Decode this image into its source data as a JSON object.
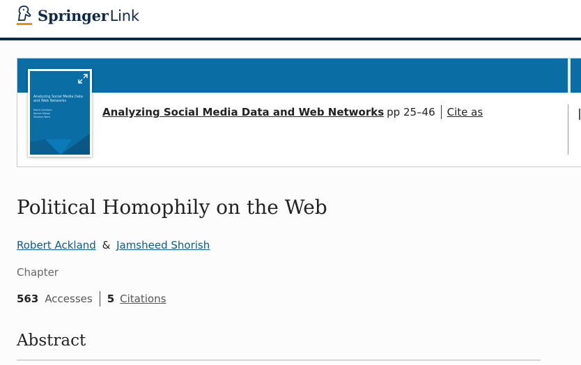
{
  "header": {
    "logo": {
      "brand": "Springer",
      "suffix": "Link",
      "icon": "springer-horse-icon",
      "color": "#0e2a4a",
      "accent": "#f08c00"
    }
  },
  "book": {
    "cover": {
      "title": "Analyzing Social Media Data and Web Networks",
      "editors": [
        "Marta Cantijoch",
        "Rachel Gibson",
        "Stephen Ward"
      ],
      "color": "#0a6ea5"
    },
    "title": "Analyzing Social Media Data and Web Networks",
    "pages": "pp 25–46",
    "cite_label": "Cite as",
    "band_color": "#0a6ea5"
  },
  "chapter": {
    "title": "Political Homophily on the Web",
    "authors": [
      {
        "name": "Robert Ackland"
      },
      {
        "name": "Jamsheed Shorish"
      }
    ],
    "author_separator": "&",
    "content_type": "Chapter",
    "metrics": {
      "accesses_count": "563",
      "accesses_label": "Accesses",
      "citations_count": "5",
      "citations_label": "Citations"
    },
    "abstract_heading": "Abstract"
  }
}
